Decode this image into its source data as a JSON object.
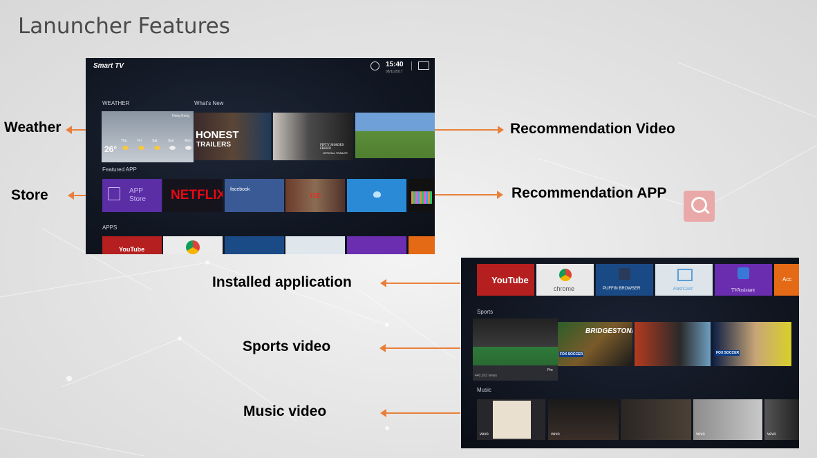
{
  "title": "Lanuncher Features",
  "labels": {
    "weather": "Weather",
    "store": "Store",
    "rec_video": "Recommendation Video",
    "rec_app": "Recommendation APP",
    "installed": "Installed application",
    "sports": "Sports video",
    "music": "Music video"
  },
  "tv": {
    "brand": "Smart TV",
    "time": "15:40",
    "date": "08/11/2017",
    "sections": {
      "weather": "WEATHER",
      "whats_new": "What's New",
      "featured": "Featured APP",
      "apps": "APPS",
      "sports": "Sports",
      "music": "Music"
    },
    "weather": {
      "city": "Hong Kong",
      "temp": "26°",
      "days": [
        "Thu",
        "Fri",
        "Sat",
        "Sun",
        "Mon"
      ]
    },
    "videos": {
      "honest1": "HONEST",
      "honest2": "TRAILERS",
      "fifty": "FIFTY SHADES FREED",
      "fifty_sub": "OFFICIAL TRAILER"
    },
    "featured": {
      "store1": "APP",
      "store2": "Store",
      "netflix": "NETFLIX",
      "facebook": "facebook",
      "ted": "TED"
    },
    "apps": {
      "youtube": "YouTube",
      "chrome": "chrome",
      "puffin": "PUFFIN BROWSER",
      "fastcast": "FastCast",
      "tvassistant": "TVAssistant",
      "acc": "Acc"
    },
    "sports": {
      "views": "440,103 views",
      "pre": "Pre",
      "fox": "FOX SOCCER",
      "bridgestone": "BRIDGESTONE"
    },
    "music": {
      "vevo": "vevo"
    }
  },
  "colors": {
    "accent": "#e8803a",
    "title": "#4a4a4a",
    "search_badge": "#eaa9a9"
  }
}
